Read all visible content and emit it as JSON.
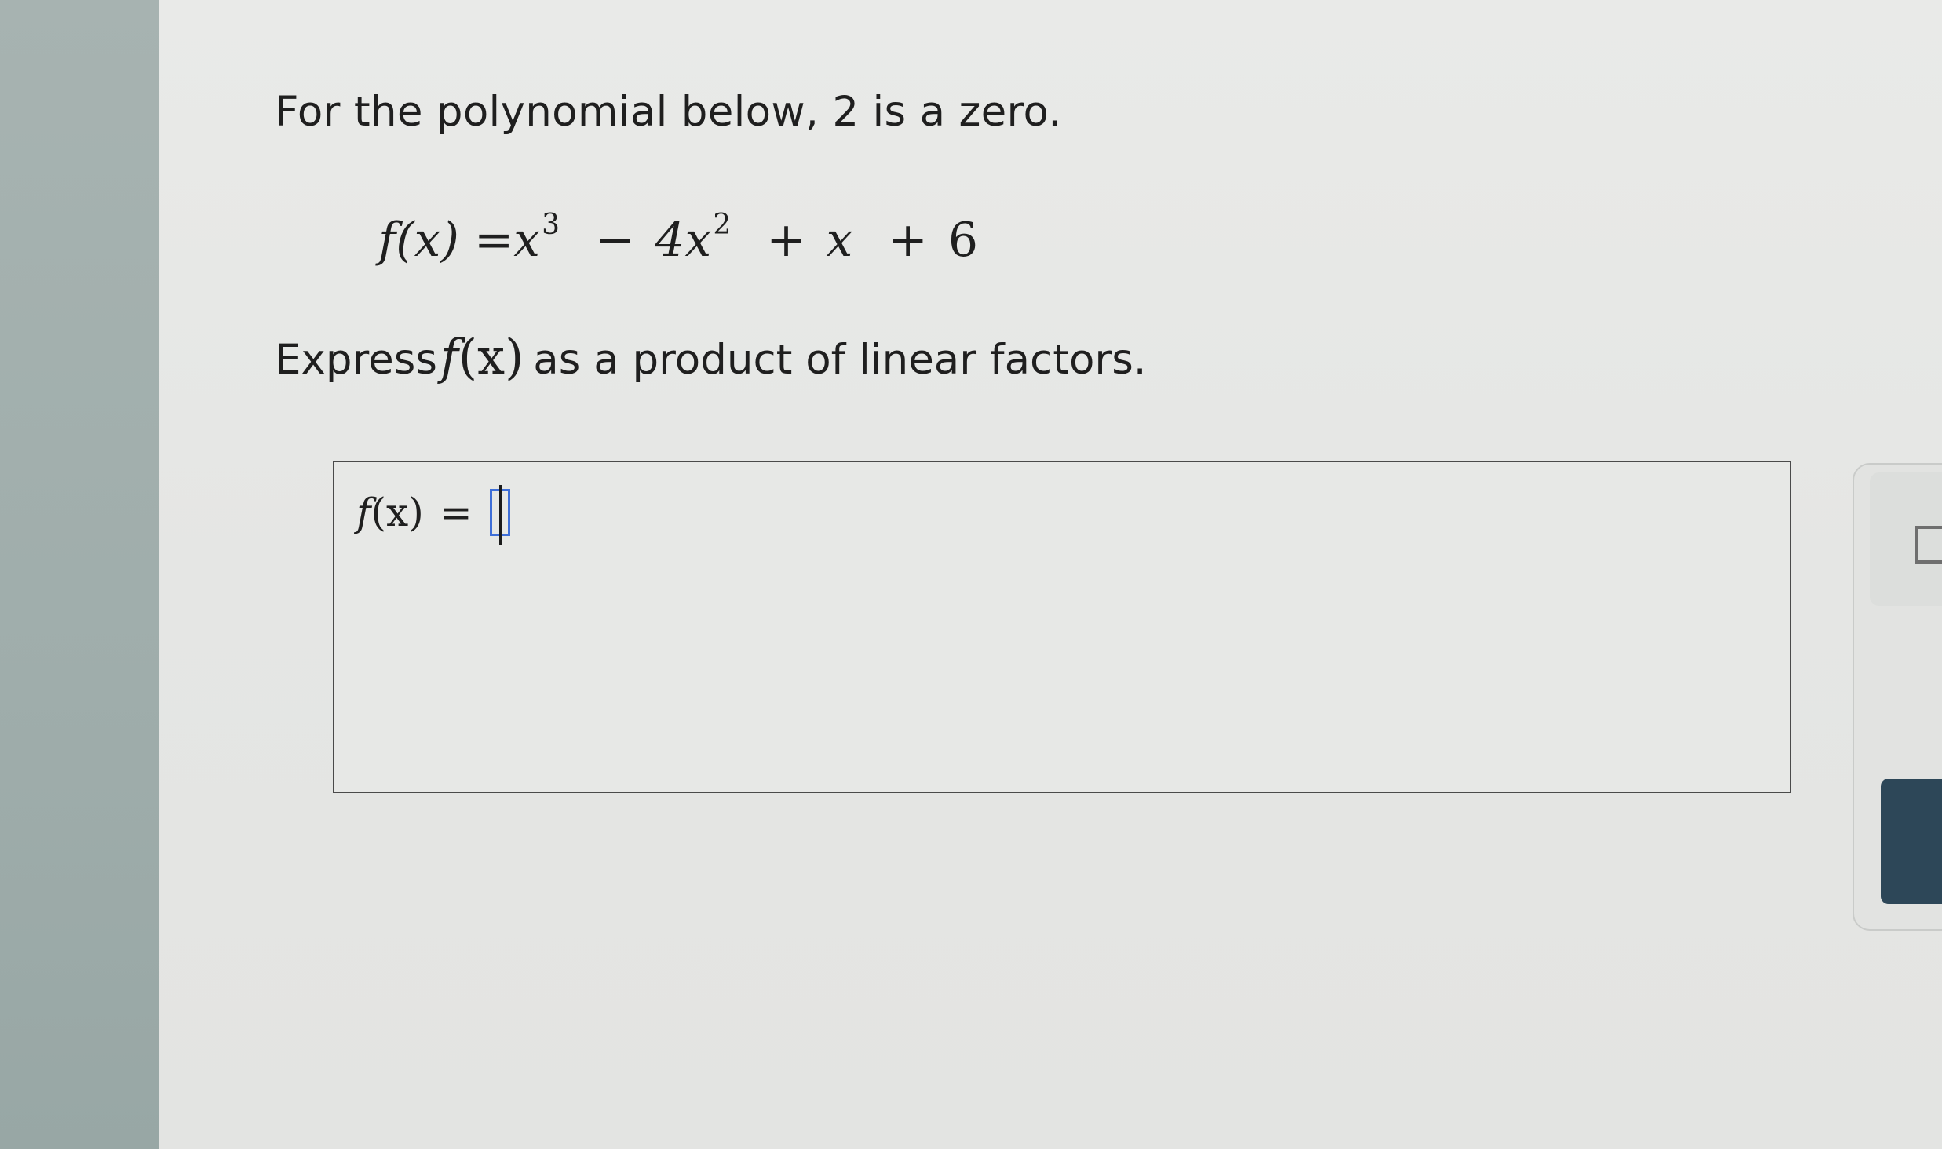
{
  "problem": {
    "statement_prefix": "For the polynomial below, ",
    "zero_value": "2",
    "statement_suffix": " is a zero.",
    "equation": {
      "lhs": "f(x)",
      "equals": "=",
      "x1": "x",
      "exp1": "3",
      "op1": "−",
      "coef2": "4x",
      "exp2": "2",
      "op2": "+",
      "x3": "x",
      "op3": "+",
      "const": "6"
    },
    "instruction_prefix": "Express",
    "instruction_func": "f",
    "instruction_arg": "(x)",
    "instruction_suffix": "as a product of linear factors."
  },
  "answer": {
    "func": "f",
    "arg": "(x)",
    "equals": "=",
    "value": ""
  },
  "toolbar": {
    "icons": [
      "square-icon"
    ]
  },
  "colors": {
    "answer_slot_border": "#3f6fd8",
    "dark_button": "#2d4758"
  }
}
